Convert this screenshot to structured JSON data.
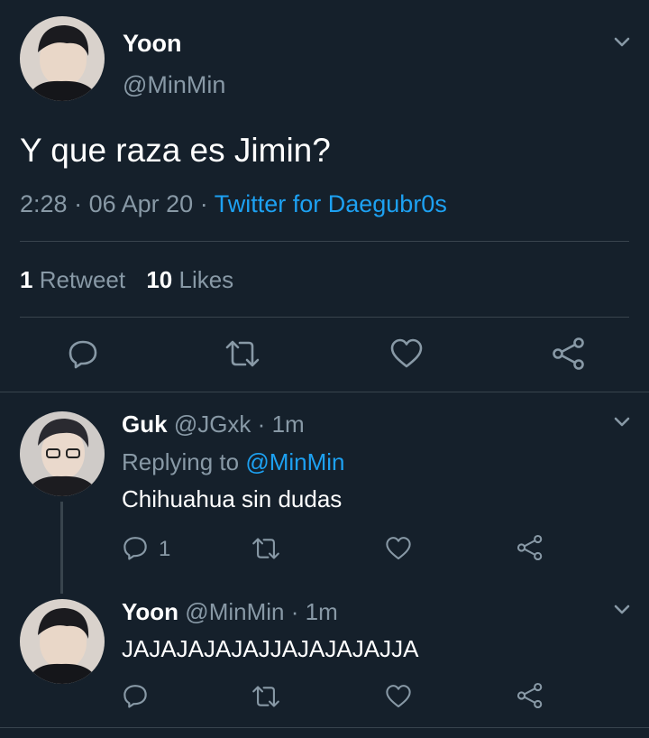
{
  "main_tweet": {
    "display_name": "Yoon",
    "handle": "@MinMin",
    "text": "Y que raza es Jimin?",
    "time": "2:28",
    "sep1": "·",
    "date": "06 Apr 20",
    "sep2": "·",
    "source": "Twitter for Daegubr0s",
    "retweet_count": "1",
    "retweet_label": "Retweet",
    "like_count": "10",
    "like_label": "Likes"
  },
  "replies": [
    {
      "display_name": "Guk",
      "handle": "@JGxk",
      "sep": "·",
      "time": "1m",
      "replying_prefix": "Replying to",
      "replying_handle": "@MinMin",
      "text": "Chihuahua sin dudas",
      "reply_count": "1"
    },
    {
      "display_name": "Yoon",
      "handle": "@MinMin",
      "sep": "·",
      "time": "1m",
      "text": "JAJAJAJAJAJJAJAJAJAJJA"
    }
  ],
  "colors": {
    "background": "#15202b",
    "text": "#ffffff",
    "muted": "#8899a6",
    "accent": "#1da1f2",
    "divider": "#38444d"
  },
  "icons": [
    "chevron-down-icon",
    "reply-icon",
    "retweet-icon",
    "like-icon",
    "share-icon"
  ]
}
